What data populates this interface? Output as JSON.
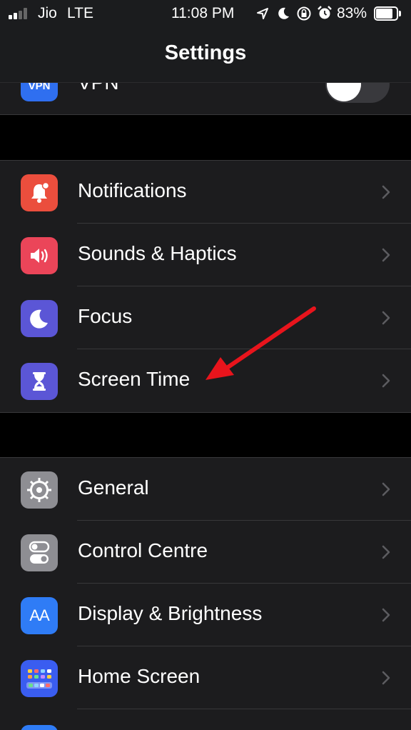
{
  "status_bar": {
    "carrier": "Jio",
    "network": "LTE",
    "time": "11:08 PM",
    "battery_percent": "83%",
    "battery_level": 0.83,
    "signal_bars_active": 2,
    "icons": [
      "location-icon",
      "moon-icon",
      "orientation-lock-icon",
      "alarm-icon",
      "battery-icon"
    ]
  },
  "nav": {
    "title": "Settings"
  },
  "vpn": {
    "label": "VPN",
    "icon_text": "VPN",
    "enabled": false
  },
  "group1": {
    "items": [
      {
        "label": "Notifications",
        "icon": "bell-icon",
        "color": "#eb4e3d"
      },
      {
        "label": "Sounds & Haptics",
        "icon": "speaker-icon",
        "color": "#eb4559"
      },
      {
        "label": "Focus",
        "icon": "moon-icon",
        "color": "#5b56d6"
      },
      {
        "label": "Screen Time",
        "icon": "hourglass-icon",
        "color": "#5b56d6"
      }
    ]
  },
  "group2": {
    "items": [
      {
        "label": "General",
        "icon": "gear-icon",
        "color": "#8e8e93"
      },
      {
        "label": "Control Centre",
        "icon": "switches-icon",
        "color": "#8e8e93"
      },
      {
        "label": "Display & Brightness",
        "icon": "text-size-icon",
        "icon_text": "AA",
        "color": "#2f7cf6"
      },
      {
        "label": "Home Screen",
        "icon": "home-grid-icon",
        "color": "#3a5df0"
      }
    ]
  },
  "annotation": {
    "arrow_color": "#e8141c"
  }
}
